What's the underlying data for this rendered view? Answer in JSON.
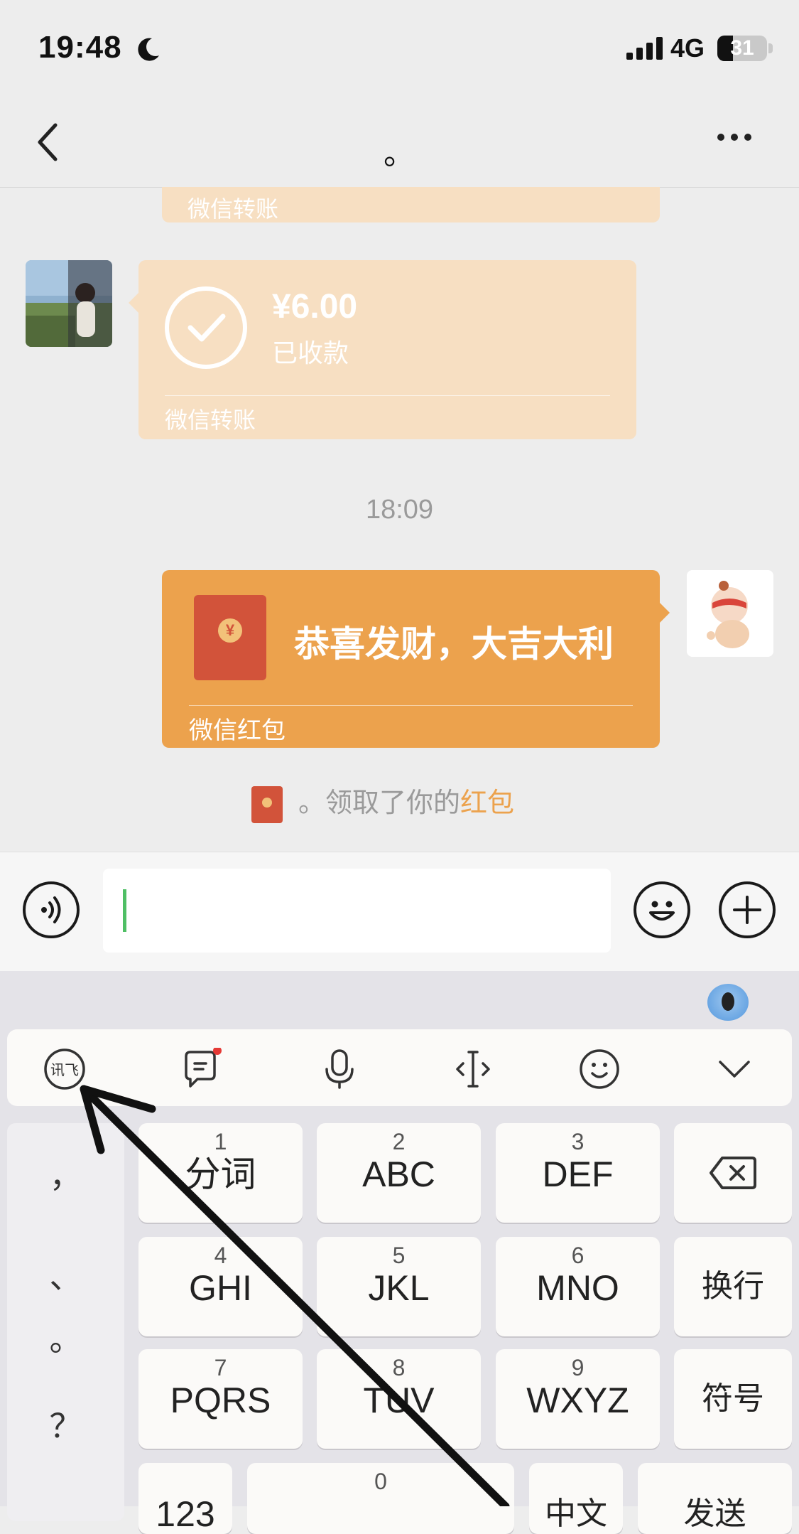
{
  "status_bar": {
    "time": "19:48",
    "network": "4G",
    "battery": "31",
    "battery_level": 0.31
  },
  "nav": {
    "title": "。"
  },
  "messages": {
    "partial_label": "微信转账",
    "transfer": {
      "amount": "¥6.00",
      "status": "已收款",
      "label": "微信转账"
    },
    "timestamp": "18:09",
    "red_packet": {
      "wish": "恭喜发财，大吉大利",
      "label": "微信红包"
    },
    "system": {
      "prefix": "。领取了你的",
      "link": "红包"
    }
  },
  "input": {
    "value": ""
  },
  "keyboard": {
    "side_punct": [
      "，",
      "、",
      "。",
      "？"
    ],
    "keys": [
      {
        "num": "1",
        "letters": "分词"
      },
      {
        "num": "2",
        "letters": "ABC"
      },
      {
        "num": "3",
        "letters": "DEF"
      },
      {
        "num": "4",
        "letters": "GHI"
      },
      {
        "num": "5",
        "letters": "JKL"
      },
      {
        "num": "6",
        "letters": "MNO"
      },
      {
        "num": "7",
        "letters": "PQRS"
      },
      {
        "num": "8",
        "letters": "TUV"
      },
      {
        "num": "9",
        "letters": "WXYZ"
      }
    ],
    "newline": "换行",
    "symbols": "符号",
    "bottom": {
      "num_key": "123",
      "zero": "0",
      "lang": "中文",
      "send": "发送"
    }
  },
  "colors": {
    "accent_orange": "#eca24d",
    "transfer_bg": "#f7dfc2",
    "caret_green": "#4fbf65",
    "envelope_red": "#d2533a"
  }
}
